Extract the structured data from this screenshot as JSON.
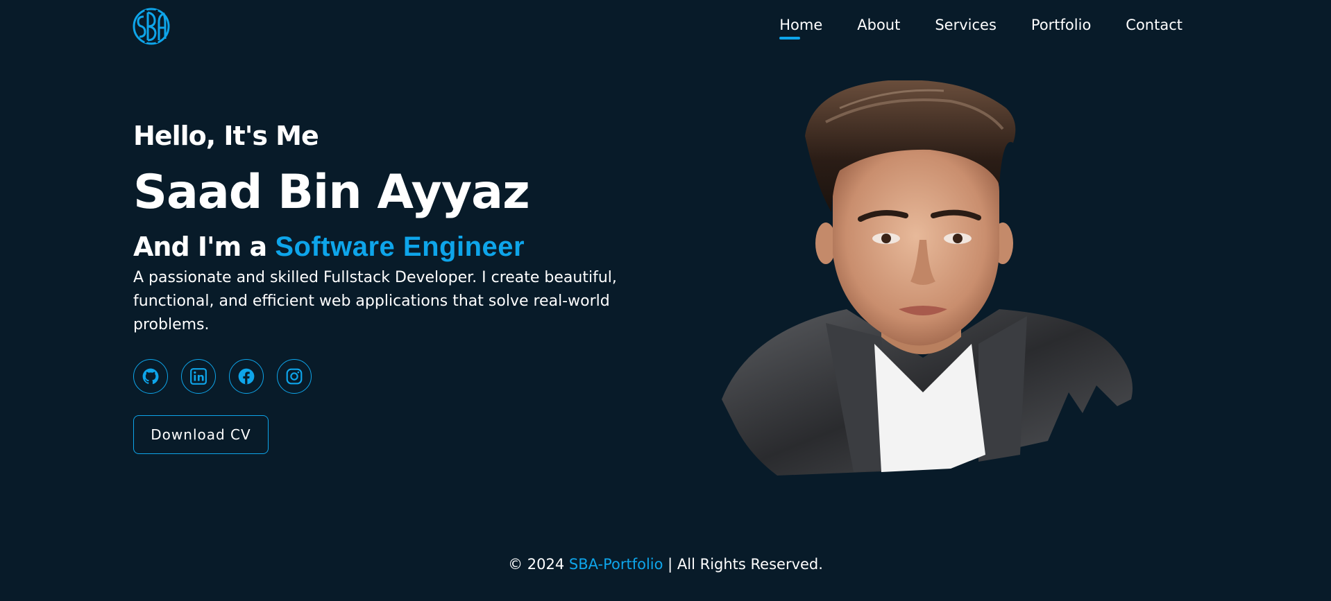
{
  "header": {
    "logo_text": "SBA",
    "nav": [
      {
        "label": "Home",
        "active": true
      },
      {
        "label": "About",
        "active": false
      },
      {
        "label": "Services",
        "active": false
      },
      {
        "label": "Portfolio",
        "active": false
      },
      {
        "label": "Contact",
        "active": false
      }
    ]
  },
  "hero": {
    "greeting": "Hello, It's Me",
    "name": "Saad Bin Ayyaz",
    "role_prefix": "And I'm a ",
    "role": "Software Engineer",
    "bio": "A passionate and skilled Fullstack Developer. I create beautiful, functional, and efficient web applications that solve real-world problems.",
    "socials": [
      {
        "icon": "github-icon"
      },
      {
        "icon": "linkedin-icon"
      },
      {
        "icon": "facebook-icon"
      },
      {
        "icon": "instagram-icon"
      }
    ],
    "cv_button": "Download CV"
  },
  "footer": {
    "prefix": "© 2024 ",
    "brand": "SBA-Portfolio",
    "suffix": " | All Rights Reserved."
  },
  "colors": {
    "background": "#081b29",
    "accent": "#0ea5ea",
    "text": "#ffffff"
  }
}
